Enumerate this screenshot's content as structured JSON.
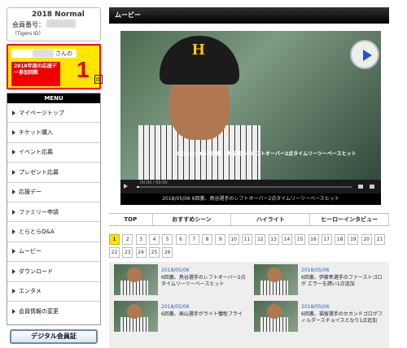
{
  "member": {
    "plan": "2018 Normal",
    "number_label": "会員番号：",
    "sub": "（Tigers ID）"
  },
  "promo": {
    "suffix": "さんの",
    "label": "2018年度の応援デー参加回数",
    "count": "1",
    "unit": "回"
  },
  "menu": {
    "head": "MENU",
    "items": [
      "マイページトップ",
      "チケット購入",
      "イベント応募",
      "プレゼント応募",
      "応援デー",
      "ファミリー申請",
      "とらとらQ&A",
      "ムービー",
      "ダウンロード",
      "エンタメ",
      "会員情報の変更"
    ]
  },
  "digital_card": "デジタル会員証",
  "page_title": "ムービー",
  "player": {
    "caption": "2018/05/06 6回裏、鳥谷選手のレフトオーバー2点タイムリーツーベースヒット",
    "overlay": "2018/05/06 6回裏、鳥谷選手のレフトオーバー2点タイムリーツーベースヒット",
    "time": "00:00 / 00:00",
    "progress": 0.01
  },
  "tabs": [
    "TOP",
    "おすすめシーン",
    "ハイライト",
    "ヒーローインタビュー"
  ],
  "pagination": {
    "current": "1",
    "pages": [
      "1",
      "2",
      "3",
      "4",
      "5",
      "6",
      "7",
      "8",
      "9",
      "10",
      "11",
      "12",
      "13",
      "14",
      "15",
      "16",
      "17",
      "18",
      "19",
      "20",
      "21",
      "22",
      "23",
      "24",
      "25",
      "26"
    ]
  },
  "videos": [
    {
      "date": "2018/05/06",
      "title": "6回裏、鳥谷選手のレフトオーバー2点タイムリーツーベースヒット"
    },
    {
      "date": "2018/05/06",
      "title": "6回裏、伊藤隼選手のファーストゴロが エラーを誘い1点追加"
    },
    {
      "date": "2018/05/06",
      "title": "6回裏、高山選手がライト犠牲フライ"
    },
    {
      "date": "2018/05/06",
      "title": "6回裏、福留選手のセカンドゴロがフィルダースチョイスとなり1点追加"
    }
  ]
}
